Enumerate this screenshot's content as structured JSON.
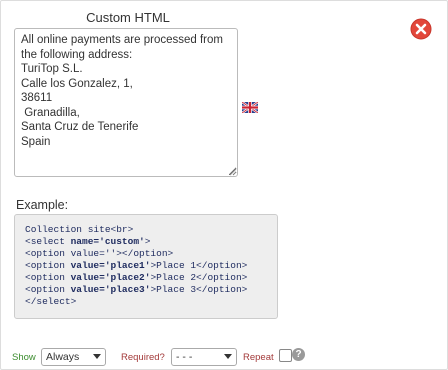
{
  "title": "Custom HTML",
  "textarea": {
    "value": "All online payments are processed from the following address:\nTuriTop S.L.\nCalle los Gonzalez, 1,\n38611\n Granadilla,\nSanta Cruz de Tenerife\nSpain"
  },
  "example": {
    "label": "Example:",
    "code_lines": [
      "Collection site<br>",
      "<select name='custom'>",
      "<option value=''></option>",
      "<option value='place1'>Place 1</option>",
      "<option value='place2'>Place 2</option>",
      "<option value='place3'>Place 3</option>",
      "</select>"
    ]
  },
  "footer": {
    "show_label": "Show",
    "show_value": "Always",
    "required_label": "Required?",
    "required_value": "- - -",
    "repeat_label": "Repeat",
    "help_symbol": "?"
  },
  "icons": {
    "close": "close-circle-icon",
    "flag": "uk-flag-icon",
    "help": "help-icon"
  },
  "colors": {
    "close_red": "#e2473b",
    "code_bg": "#eeeeee",
    "code_text": "#1d2a5e",
    "show_label": "#3c8d2f",
    "required_label": "#a33a3a"
  }
}
